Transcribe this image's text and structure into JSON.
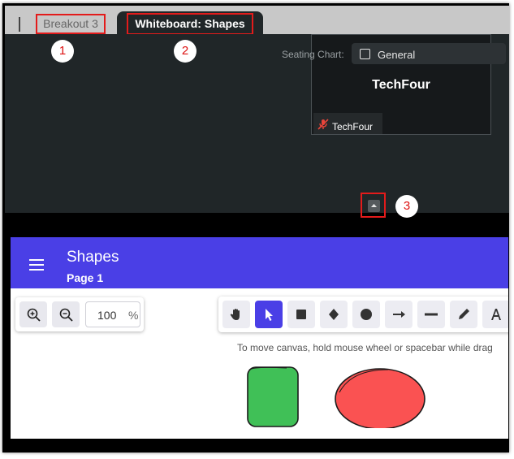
{
  "meeting": {
    "tabs": [
      {
        "label": "Breakout 3",
        "marker": "1"
      },
      {
        "label": "Whiteboard: Shapes",
        "marker": "2"
      }
    ],
    "seating_chart_label": "Seating Chart:",
    "seating_chart_value": "General",
    "video_tile_name": "TechFour",
    "video_tile_footer_name": "TechFour",
    "collapse_marker": "3"
  },
  "whiteboard": {
    "title": "Shapes",
    "page": "Page 1",
    "zoom": {
      "value": "100",
      "unit": "%"
    },
    "tools": [
      "hand-icon",
      "select-icon",
      "rectangle-icon",
      "diamond-icon",
      "ellipse-icon",
      "arrow-icon",
      "line-icon",
      "pencil-icon",
      "text-icon"
    ],
    "active_tool": "select-icon",
    "hint": "To move canvas, hold mouse wheel or spacebar while drag",
    "shapes": [
      {
        "type": "rounded-rectangle",
        "fill": "#40c057"
      },
      {
        "type": "ellipse",
        "fill": "#fa5252"
      }
    ]
  },
  "colors": {
    "accent": "#4a3fe6",
    "annotation": "#e31b1b",
    "meeting_bg": "#202628"
  }
}
